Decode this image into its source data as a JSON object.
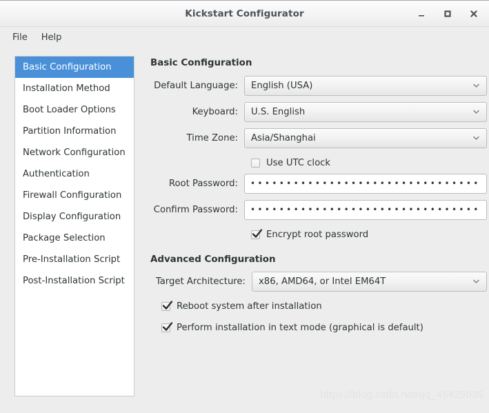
{
  "window": {
    "title": "Kickstart Configurator",
    "controls": [
      {
        "name": "minimize-button",
        "glyph": "minimize-icon",
        "label": "_"
      },
      {
        "name": "maximize-button",
        "glyph": "maximize-icon",
        "label": "□"
      },
      {
        "name": "close-button",
        "glyph": "close-icon",
        "label": "✕"
      }
    ]
  },
  "menubar": {
    "items": [
      {
        "label": "File"
      },
      {
        "label": "Help"
      }
    ]
  },
  "sidebar": {
    "selected_index": 0,
    "items": [
      {
        "label": "Basic Configuration"
      },
      {
        "label": "Installation Method"
      },
      {
        "label": "Boot Loader Options"
      },
      {
        "label": "Partition Information"
      },
      {
        "label": "Network Configuration"
      },
      {
        "label": "Authentication"
      },
      {
        "label": "Firewall Configuration"
      },
      {
        "label": "Display Configuration"
      },
      {
        "label": "Package Selection"
      },
      {
        "label": "Pre-Installation Script"
      },
      {
        "label": "Post-Installation Script"
      }
    ]
  },
  "basic": {
    "title": "Basic Configuration",
    "language": {
      "label": "Default Language:",
      "value": "English (USA)",
      "icon": "chevron-down-icon"
    },
    "keyboard": {
      "label": "Keyboard:",
      "value": "U.S. English",
      "icon": "chevron-down-icon"
    },
    "timezone": {
      "label": "Time Zone:",
      "value": "Asia/Shanghai",
      "icon": "chevron-down-icon"
    },
    "utc_clock": {
      "label": "Use UTC clock",
      "checked": false
    },
    "root_password": {
      "label": "Root Password:",
      "value": "••••••••••••••••••••••••••••••••"
    },
    "confirm_password": {
      "label": "Confirm Password:",
      "value": "••••••••••••••••••••••••••••••••"
    },
    "encrypt_root_password": {
      "label": "Encrypt root password",
      "checked": true
    }
  },
  "advanced": {
    "title": "Advanced Configuration",
    "target_architecture": {
      "label": "Target Architecture:",
      "value": "x86, AMD64, or Intel EM64T",
      "icon": "chevron-down-icon"
    },
    "reboot_after_install": {
      "label": "Reboot system after installation",
      "checked": true
    },
    "text_mode_install": {
      "label": "Perform installation in text mode (graphical is default)",
      "checked": true
    }
  },
  "watermark": {
    "text": "https://blog.csdn.net/qq_45425035"
  },
  "colors": {
    "accent": "#4a90d9",
    "window_bg": "#ededed",
    "panel_bg": "#ffffff",
    "text": "#2e3436"
  }
}
